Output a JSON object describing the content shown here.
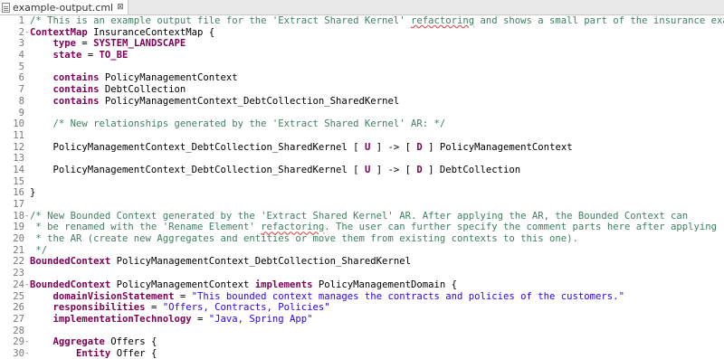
{
  "tab": {
    "title": "example-output.cml",
    "close_glyph": "⊠"
  },
  "lines": [
    {
      "n": "1",
      "fold": "",
      "segs": [
        [
          "cm",
          "/* This is an example output file for the 'Extract Shared Kernel' "
        ],
        [
          "cm sq",
          "refactoring"
        ],
        [
          "cm",
          " and shows a small part of the insurance exam"
        ]
      ]
    },
    {
      "n": "2",
      "fold": "-",
      "segs": [
        [
          "kw",
          "ContextMap"
        ],
        [
          "",
          "InsuranceContextMap {"
        ]
      ]
    },
    {
      "n": "3",
      "fold": "",
      "segs": [
        [
          "",
          "    "
        ],
        [
          "kw",
          "type"
        ],
        [
          "",
          " = "
        ],
        [
          "kw",
          "SYSTEM_LANDSCAPE"
        ]
      ]
    },
    {
      "n": "4",
      "fold": "",
      "segs": [
        [
          "",
          "    "
        ],
        [
          "kw",
          "state"
        ],
        [
          "",
          " = "
        ],
        [
          "kw",
          "TO_BE"
        ]
      ]
    },
    {
      "n": "5",
      "fold": "",
      "segs": []
    },
    {
      "n": "6",
      "fold": "",
      "segs": [
        [
          "",
          "    "
        ],
        [
          "kw",
          "contains"
        ],
        [
          "",
          " PolicyManagementContext"
        ]
      ]
    },
    {
      "n": "7",
      "fold": "",
      "segs": [
        [
          "",
          "    "
        ],
        [
          "kw",
          "contains"
        ],
        [
          "",
          " DebtCollection"
        ]
      ]
    },
    {
      "n": "8",
      "fold": "",
      "segs": [
        [
          "",
          "    "
        ],
        [
          "kw",
          "contains"
        ],
        [
          "",
          " PolicyManagementContext_DebtCollection_SharedKernel"
        ]
      ]
    },
    {
      "n": "9",
      "fold": "",
      "segs": []
    },
    {
      "n": "10",
      "fold": "",
      "segs": [
        [
          "",
          "    "
        ],
        [
          "cm",
          "/* New relationships generated by the 'Extract Shared Kernel' AR: */"
        ]
      ]
    },
    {
      "n": "11",
      "fold": "",
      "segs": []
    },
    {
      "n": "12",
      "fold": "",
      "segs": [
        [
          "",
          "    PolicyManagementContext_DebtCollection_SharedKernel [ "
        ],
        [
          "brk",
          "U"
        ],
        [
          "",
          " ] -> [ "
        ],
        [
          "brk",
          "D"
        ],
        [
          "",
          " ] PolicyManagementContext"
        ]
      ]
    },
    {
      "n": "13",
      "fold": "",
      "segs": []
    },
    {
      "n": "14",
      "fold": "",
      "segs": [
        [
          "",
          "    PolicyManagementContext_DebtCollection_SharedKernel [ "
        ],
        [
          "brk",
          "U"
        ],
        [
          "",
          " ] -> [ "
        ],
        [
          "brk",
          "D"
        ],
        [
          "",
          " ] DebtCollection"
        ]
      ]
    },
    {
      "n": "15",
      "fold": "",
      "segs": []
    },
    {
      "n": "16",
      "fold": "",
      "segs": [
        [
          "",
          "}"
        ]
      ]
    },
    {
      "n": "17",
      "fold": "",
      "segs": []
    },
    {
      "n": "18",
      "fold": "-",
      "segs": [
        [
          "cm",
          "/* New Bounded Context generated by the 'Extract Shared Kernel' AR. After applying the AR, the Bounded Context can"
        ]
      ]
    },
    {
      "n": "19",
      "fold": "",
      "segs": [
        [
          "cm",
          " * be renamed with the 'Rename Element' "
        ],
        [
          "cm sq",
          "refactoring"
        ],
        [
          "cm",
          ". The user can further specify the comment parts here after applying"
        ]
      ]
    },
    {
      "n": "20",
      "fold": "",
      "segs": [
        [
          "cm",
          " * the AR (create new Aggregates and entities or move them from existing contexts to this one)."
        ]
      ]
    },
    {
      "n": "21",
      "fold": "",
      "segs": [
        [
          "cm",
          " */"
        ]
      ]
    },
    {
      "n": "22",
      "fold": "",
      "segs": [
        [
          "kw",
          "BoundedContext"
        ],
        [
          "",
          " PolicyManagementContext_DebtCollection_SharedKernel"
        ]
      ]
    },
    {
      "n": "23",
      "fold": "",
      "segs": []
    },
    {
      "n": "24",
      "fold": "-",
      "segs": [
        [
          "kw",
          "BoundedContext"
        ],
        [
          "",
          " PolicyManagementContext "
        ],
        [
          "kw",
          "implements"
        ],
        [
          "",
          " PolicyManagementDomain {"
        ]
      ]
    },
    {
      "n": "25",
      "fold": "",
      "segs": [
        [
          "",
          "    "
        ],
        [
          "kw",
          "domainVisionStatement"
        ],
        [
          "",
          " = "
        ],
        [
          "str",
          "\"This bounded context manages the contracts and policies of the customers.\""
        ]
      ]
    },
    {
      "n": "26",
      "fold": "",
      "segs": [
        [
          "",
          "    "
        ],
        [
          "kw",
          "responsibilities"
        ],
        [
          "",
          " = "
        ],
        [
          "str",
          "\"Offers, Contracts, Policies\""
        ]
      ]
    },
    {
      "n": "27",
      "fold": "",
      "segs": [
        [
          "",
          "    "
        ],
        [
          "kw",
          "implementationTechnology"
        ],
        [
          "",
          " = "
        ],
        [
          "str",
          "\"Java, Spring App\""
        ]
      ]
    },
    {
      "n": "28",
      "fold": "",
      "segs": []
    },
    {
      "n": "29",
      "fold": "-",
      "segs": [
        [
          "",
          "    "
        ],
        [
          "kw",
          "Aggregate"
        ],
        [
          "",
          " Offers {"
        ]
      ]
    },
    {
      "n": "30",
      "fold": "-",
      "segs": [
        [
          "",
          "        "
        ],
        [
          "kw",
          "Entity"
        ],
        [
          "",
          " Offer {"
        ]
      ]
    }
  ]
}
